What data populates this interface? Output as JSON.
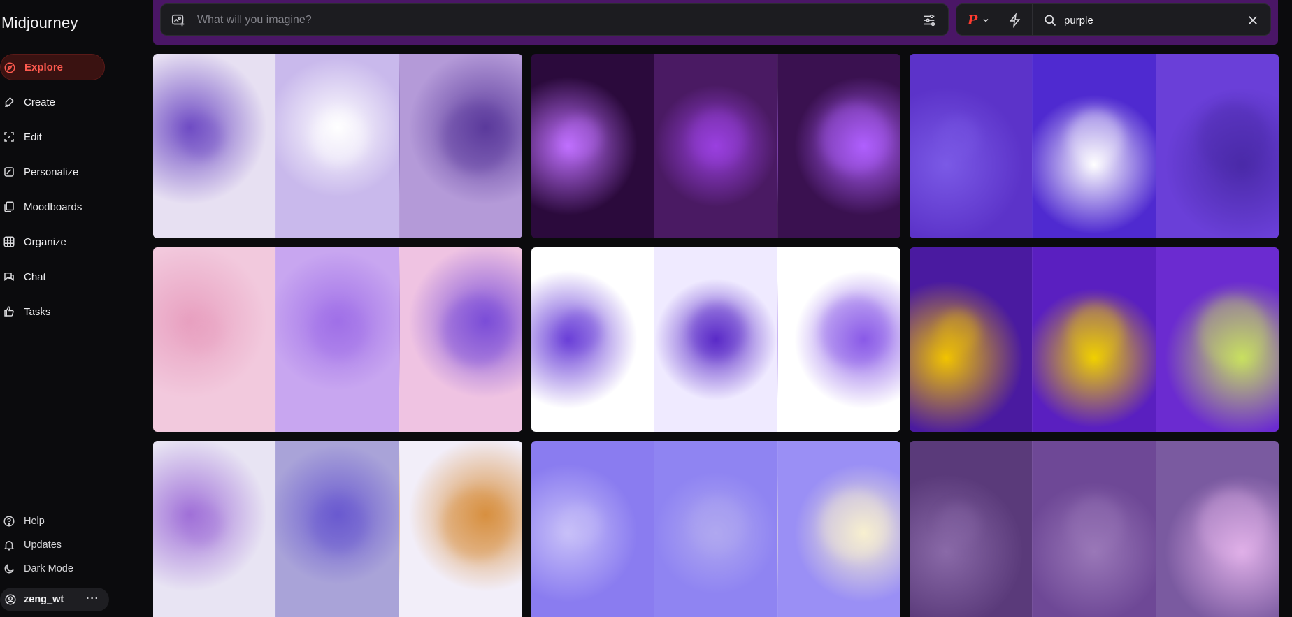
{
  "sidebar": {
    "brand": "Midjourney",
    "nav": [
      {
        "label": "Explore",
        "icon": "compass-icon",
        "active": true
      },
      {
        "label": "Create",
        "icon": "brush-icon"
      },
      {
        "label": "Edit",
        "icon": "edit-frame-icon"
      },
      {
        "label": "Personalize",
        "icon": "personalize-icon"
      },
      {
        "label": "Moodboards",
        "icon": "moodboard-icon"
      },
      {
        "label": "Organize",
        "icon": "grid-icon"
      },
      {
        "label": "Chat",
        "icon": "chat-icon"
      },
      {
        "label": "Tasks",
        "icon": "thumbs-up-icon"
      }
    ],
    "bottom": [
      {
        "label": "Help",
        "icon": "help-icon"
      },
      {
        "label": "Updates",
        "icon": "bell-icon"
      },
      {
        "label": "Dark Mode",
        "icon": "moon-icon"
      }
    ],
    "user": {
      "name": "zeng_wt",
      "more": "···"
    }
  },
  "imagine": {
    "placeholder": "What will you imagine?"
  },
  "search": {
    "value": "purple",
    "profile_mark": "P"
  },
  "colors": {
    "accent": "#ff5a4f",
    "active_bg": "#3a1211",
    "bar_bg": "#1c1c20",
    "page_bg": "#0b0b0d"
  },
  "gallery": [
    {
      "panels": [
        "#e7e0f2",
        "#c9b9ec",
        "#b49ad8"
      ]
    },
    {
      "panels": [
        "#2b0a3c",
        "#4a1a63",
        "#3a1150"
      ]
    },
    {
      "panels": [
        "#5c33c9",
        "#4f2ad0",
        "#6a3fd8"
      ]
    },
    {
      "panels": [
        "#f2c9dd",
        "#c8a6f0",
        "#efc3e2"
      ]
    },
    {
      "panels": [
        "#ffffff",
        "#efeaff",
        "#ffffff"
      ]
    },
    {
      "panels": [
        "#4a1aa0",
        "#5a1fc0",
        "#6b2bd0"
      ]
    },
    {
      "panels": [
        "#e8e4f3",
        "#a9a3d8",
        "#f2eef9"
      ]
    },
    {
      "panels": [
        "#8a7cf0",
        "#8f84f2",
        "#9a8ff5"
      ]
    },
    {
      "panels": [
        "#5a3a7a",
        "#6e4896",
        "#7a5aa0"
      ]
    }
  ],
  "top_strip": {
    "panels": [
      "#5b1a6a",
      "#1a0c24",
      "#3a2060"
    ]
  }
}
